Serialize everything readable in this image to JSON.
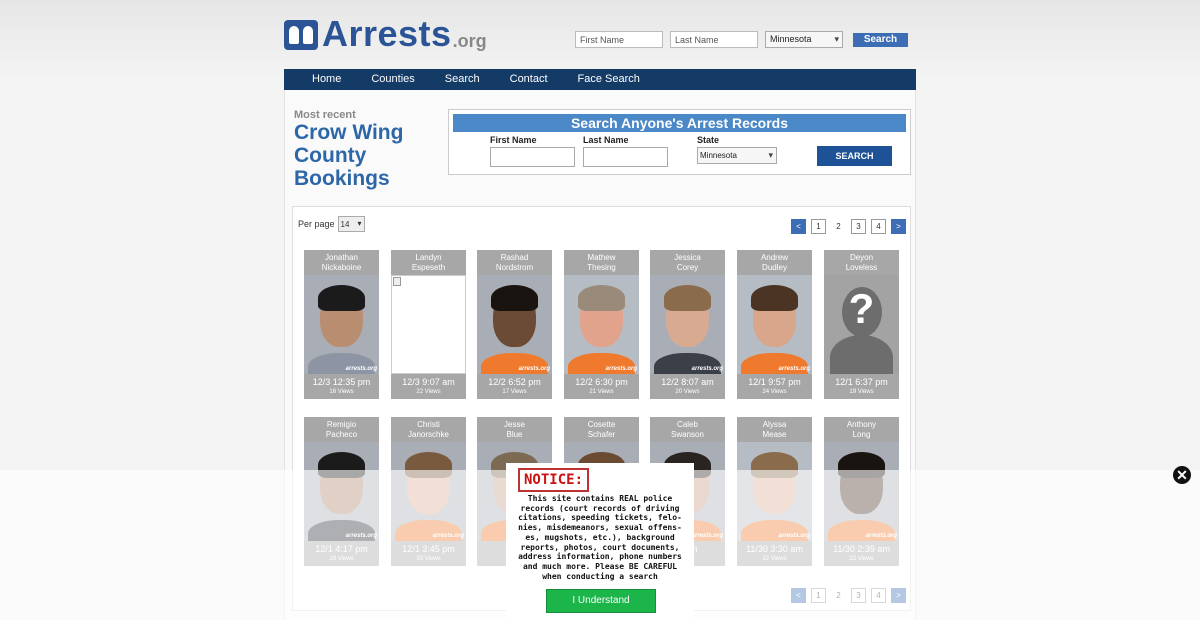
{
  "header": {
    "logo_main": "Arrests",
    "logo_suffix": ".org",
    "first_name_placeholder": "First Name",
    "last_name_placeholder": "Last Name",
    "state_selected": "Minnesota",
    "search_label": "Search"
  },
  "nav": {
    "items": [
      {
        "label": "Home"
      },
      {
        "label": "Counties"
      },
      {
        "label": "Search"
      },
      {
        "label": "Contact"
      },
      {
        "label": "Face Search"
      }
    ]
  },
  "page": {
    "most_recent": "Most recent",
    "title": "Crow Wing County Bookings"
  },
  "search_box": {
    "heading": "Search Anyone's Arrest Records",
    "first_name_label": "First Name",
    "last_name_label": "Last Name",
    "state_label": "State",
    "state_selected": "Minnesota",
    "button_label": "SEARCH"
  },
  "listing": {
    "per_page_label": "Per page",
    "per_page_value": "14",
    "pagination": [
      "<",
      "1",
      "2",
      "3",
      "4",
      ">"
    ],
    "current_page": "2",
    "bookings": [
      {
        "first": "Jonathan",
        "last": "Nickaboine",
        "datetime": "12/3 12:35 pm",
        "views": "16 Views",
        "skin": "#b98d70",
        "hair": "#1b1b1b",
        "shirt": "#8d95a4",
        "bg": "#a9aeb6"
      },
      {
        "first": "Landyn",
        "last": "Espeseth",
        "datetime": "12/3 9:07 am",
        "views": "22 Views",
        "photo": "missing"
      },
      {
        "first": "Rashad",
        "last": "Nordstrom",
        "datetime": "12/2 6:52 pm",
        "views": "17 Views",
        "skin": "#6b4a36",
        "hair": "#1a1410",
        "shirt": "#ef7a2e",
        "bg": "#a9aeb6"
      },
      {
        "first": "Mathew",
        "last": "Thesing",
        "datetime": "12/2 6:30 pm",
        "views": "21 Views",
        "skin": "#e2a38c",
        "hair": "#9a8a7a",
        "shirt": "#ef7a2e",
        "bg": "#b6bcc3"
      },
      {
        "first": "Jessica",
        "last": "Corey",
        "datetime": "12/2 8:07 am",
        "views": "20 Views",
        "skin": "#d9aa92",
        "hair": "#8a6c4c",
        "shirt": "#3b3f48",
        "bg": "#a9aeb6"
      },
      {
        "first": "Andrew",
        "last": "Dudley",
        "datetime": "12/1 9:57 pm",
        "views": "24 Views",
        "skin": "#d8a68a",
        "hair": "#4c3425",
        "shirt": "#ef7a2e",
        "bg": "#b6bcc3"
      },
      {
        "first": "Deyon",
        "last": "Loveless",
        "datetime": "12/1 6:37 pm",
        "views": "19 Views",
        "photo": "placeholder"
      },
      {
        "first": "Remigio",
        "last": "Pacheco",
        "datetime": "12/1 4:17 pm",
        "views": "19 Views",
        "skin": "#b0846a",
        "hair": "#1b1b1b",
        "shirt": "#2b2e36",
        "bg": "#a9aeb6"
      },
      {
        "first": "Christi",
        "last": "Janorschke",
        "datetime": "12/1 3:45 pm",
        "views": "30 Views",
        "skin": "#dcae96",
        "hair": "#7a5a3e",
        "shirt": "#ef7a2e",
        "bg": "#a9aeb6"
      },
      {
        "first": "Jesse",
        "last": "Blue",
        "datetime": "12/1",
        "views": "",
        "skin": "#c9a088",
        "hair": "#7c6a52",
        "shirt": "#ef7a2e",
        "bg": "#a9aeb6"
      },
      {
        "first": "Cosette",
        "last": "Schafer",
        "datetime": "",
        "views": "",
        "skin": "#d7a892",
        "hair": "#6a4a30",
        "shirt": "#3b3f48",
        "bg": "#a9aeb6"
      },
      {
        "first": "Caleb",
        "last": "Swanson",
        "datetime": "7 pm",
        "views": "",
        "skin": "#c89a80",
        "hair": "#2a2420",
        "shirt": "#ef7a2e",
        "bg": "#a9aeb6"
      },
      {
        "first": "Alyssa",
        "last": "Mease",
        "datetime": "11/30 3:30 am",
        "views": "22 Views",
        "skin": "#dcae96",
        "hair": "#8a6c4c",
        "shirt": "#ef7a2e",
        "bg": "#b6bcc3"
      },
      {
        "first": "Anthony",
        "last": "Long",
        "datetime": "11/30 2:39 am",
        "views": "22 Views",
        "skin": "#4c3326",
        "hair": "#1a1410",
        "shirt": "#ef7a2e",
        "bg": "#a9aeb6"
      }
    ],
    "watermark": "arrests.org"
  },
  "notice": {
    "title": "NOTICE:",
    "text": "This site contains REAL police records (court records of driving citations, speeding tickets, felo- nies, misdemeanors, sexual offens- es, mugshots, etc.), background reports, photos, court documents, address information, phone numbers and much more. Please BE CAREFUL when conducting a search",
    "button_label": "I Understand"
  },
  "overlay": {
    "close_icon": "close-icon",
    "close_glyph": "✕"
  }
}
